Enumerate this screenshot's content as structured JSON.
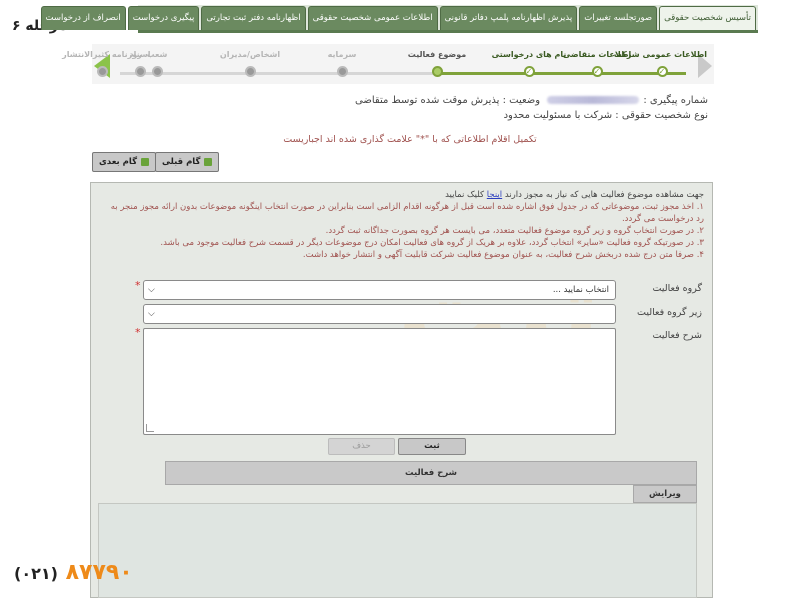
{
  "page_label": "مرحله ۶",
  "tabs": [
    {
      "label": "تأسیس شخصیت حقوقی",
      "active": true
    },
    {
      "label": "صورتجلسه تغییرات",
      "active": false
    },
    {
      "label": "پذیرش اظهارنامه پلمپ دفاتر قانونی",
      "active": false
    },
    {
      "label": "اطلاعات عمومی شخصیت حقوقی",
      "active": false
    },
    {
      "label": "اظهارنامه دفتر ثبت تجارتی",
      "active": false
    },
    {
      "label": "پیگیری درخواست",
      "active": false
    },
    {
      "label": "انصراف از درخواست",
      "active": false
    }
  ],
  "stepper": {
    "steps": [
      {
        "label": "اطلاعات عمومی شرکت",
        "state": "done"
      },
      {
        "label": "اطلاعات متقاضی",
        "state": "done"
      },
      {
        "label": "نام های درخواستی",
        "state": "done"
      },
      {
        "label": "موضوع فعالیت",
        "state": "current"
      },
      {
        "label": "سرمایه",
        "state": "todo"
      },
      {
        "label": "اشخاص/مدیران",
        "state": "todo"
      },
      {
        "label": "شعب",
        "state": "todo"
      },
      {
        "label": "روزنامه کثیرالانتشار",
        "state": "todo"
      },
      {
        "label": "اسناد",
        "state": "todo"
      }
    ]
  },
  "info": {
    "tracking_label": "شماره پیگیری :",
    "status_text": "وضعیت : پذیرش موقت شده توسط متقاضی",
    "entity_type": "نوع شخصیت حقوقی : شرکت با مسئولیت محدود"
  },
  "notice": "تکمیل اقلام اطلاعاتی که با \"*\" علامت گذاری شده اند اجباریست",
  "nav": {
    "prev_label": "گام قبلی",
    "next_label": "گام بعدی"
  },
  "guide": {
    "intro_before": "جهت مشاهده موضوع فعالیت هایی که نیاز به مجوز دارند",
    "intro_link": "اینجا",
    "intro_after": "کلیک نمایید",
    "items": [
      "۱. اخذ مجوز ثبت، موضوعاتی که در جدول فوق اشاره شده است قبل از هرگونه اقدام الزامی است بنابراین در صورت انتخاب اینگونه موضوعات بدون ارائه مجوز منجر به رد درخواست می گردد.",
      "۲. در صورت انتخاب گروه و زیر گروه موضوع فعالیت متعدد، می بایست هر گروه بصورت جداگانه ثبت گردد.",
      "۳. در صورتیکه گروه فعالیت «سایر» انتخاب گردد، علاوه بر هریک از گروه های فعالیت امکان درج موضوعات دیگر در قسمت شرح فعالیت موجود می باشد.",
      "۴. صرفا متن درج شده دربخش شرح فعالیت، به عنوان موضوع فعالیت شرکت قابلیت آگهی و انتشار خواهد داشت."
    ]
  },
  "form": {
    "activity_group_label": "گروه فعالیت",
    "activity_group_value": "انتخاب نمایید ...",
    "subgroup_label": "زیر گروه فعالیت",
    "subgroup_value": "",
    "description_label": "شرح فعالیت",
    "required_mark": "*"
  },
  "actions": {
    "submit_label": "ثبت",
    "delete_label": "حذف"
  },
  "table": {
    "header": "شرح فعالیت",
    "edit_column": "ویرایش"
  },
  "watermark": "ثبت",
  "footer_phone": {
    "code": "(۰۲۱)",
    "number": "۸۷۷۹۰"
  }
}
